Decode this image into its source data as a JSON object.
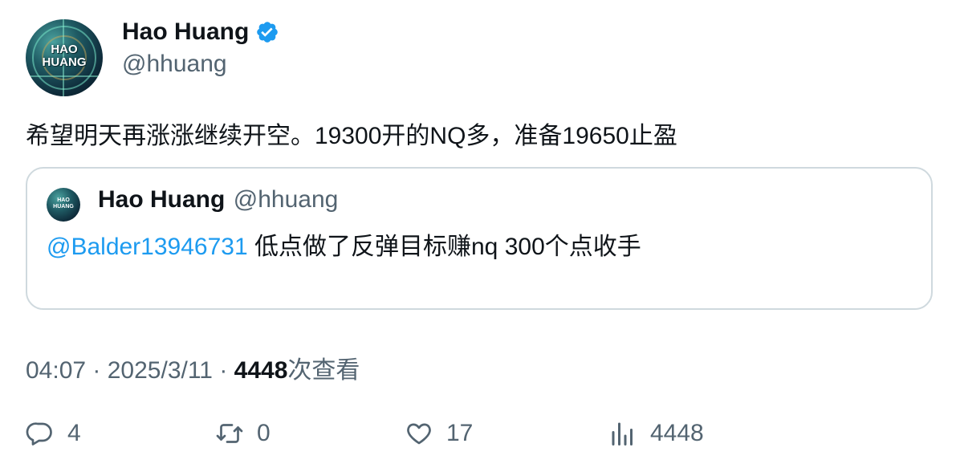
{
  "author": {
    "name": "Hao Huang",
    "handle": "@hhuang",
    "avatar_text_line1": "HAO",
    "avatar_text_line2": "HUANG"
  },
  "tweet": {
    "text": "希望明天再涨涨继续开空。19300开的NQ多，准备19650止盈"
  },
  "quoted": {
    "name": "Hao Huang",
    "handle": "@hhuang",
    "mention": "@Balder13946731",
    "text": " 低点做了反弹目标赚nq 300个点收手"
  },
  "meta": {
    "time": "04:07",
    "sep1": " · ",
    "date": "2025/3/11",
    "sep2": " · ",
    "views": "4448",
    "views_label": "次查看"
  },
  "actions": {
    "replies": "4",
    "reposts": "0",
    "likes": "17",
    "views": "4448"
  },
  "colors": {
    "accent": "#1d9bf0",
    "secondary_text": "#536471",
    "border": "#cfd9de"
  }
}
